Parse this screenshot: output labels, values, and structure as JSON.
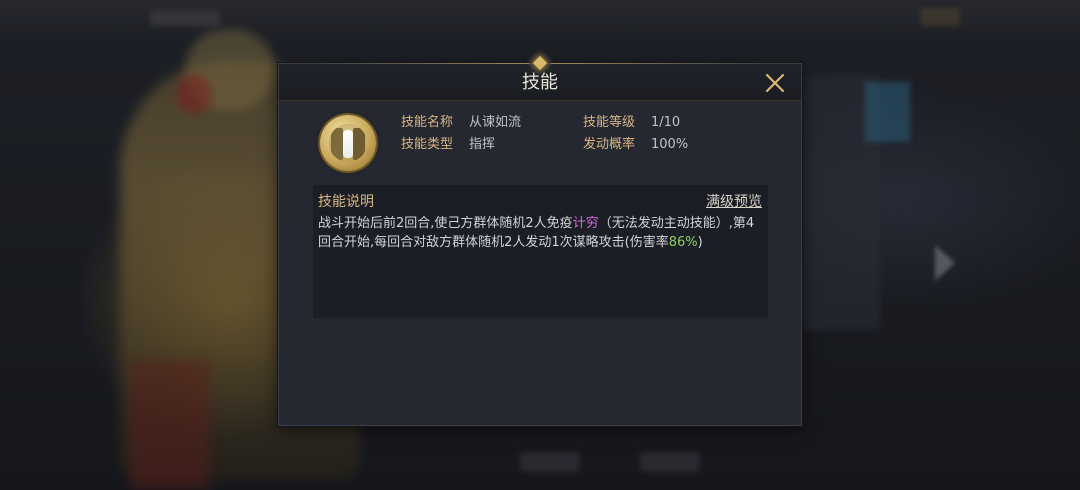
{
  "dialog": {
    "title": "技能",
    "close_icon": "close-icon",
    "skill_icon": "waterfall-skill-icon",
    "info": {
      "name_label": "技能名称",
      "name_value": "从谏如流",
      "level_label": "技能等级",
      "level_value": "1/10",
      "type_label": "技能类型",
      "type_value": "指挥",
      "rate_label": "发动概率",
      "rate_value": "100%"
    },
    "description": {
      "title": "技能说明",
      "preview_link": "满级预览",
      "text_part1": "战斗开始后前2回合,使己方群体随机2人免疫",
      "keyword1": "计穷",
      "text_part2": "（无法发动主动技能）,第4回合开始,每回合对敌方群体随机2人发动1次谋略攻击(伤害率",
      "keyword2": "86%",
      "text_part3": ")"
    }
  },
  "colors": {
    "label_gold": "#d7b682",
    "keyword_purple": "#d46ae0",
    "keyword_green": "#8bd15a"
  }
}
